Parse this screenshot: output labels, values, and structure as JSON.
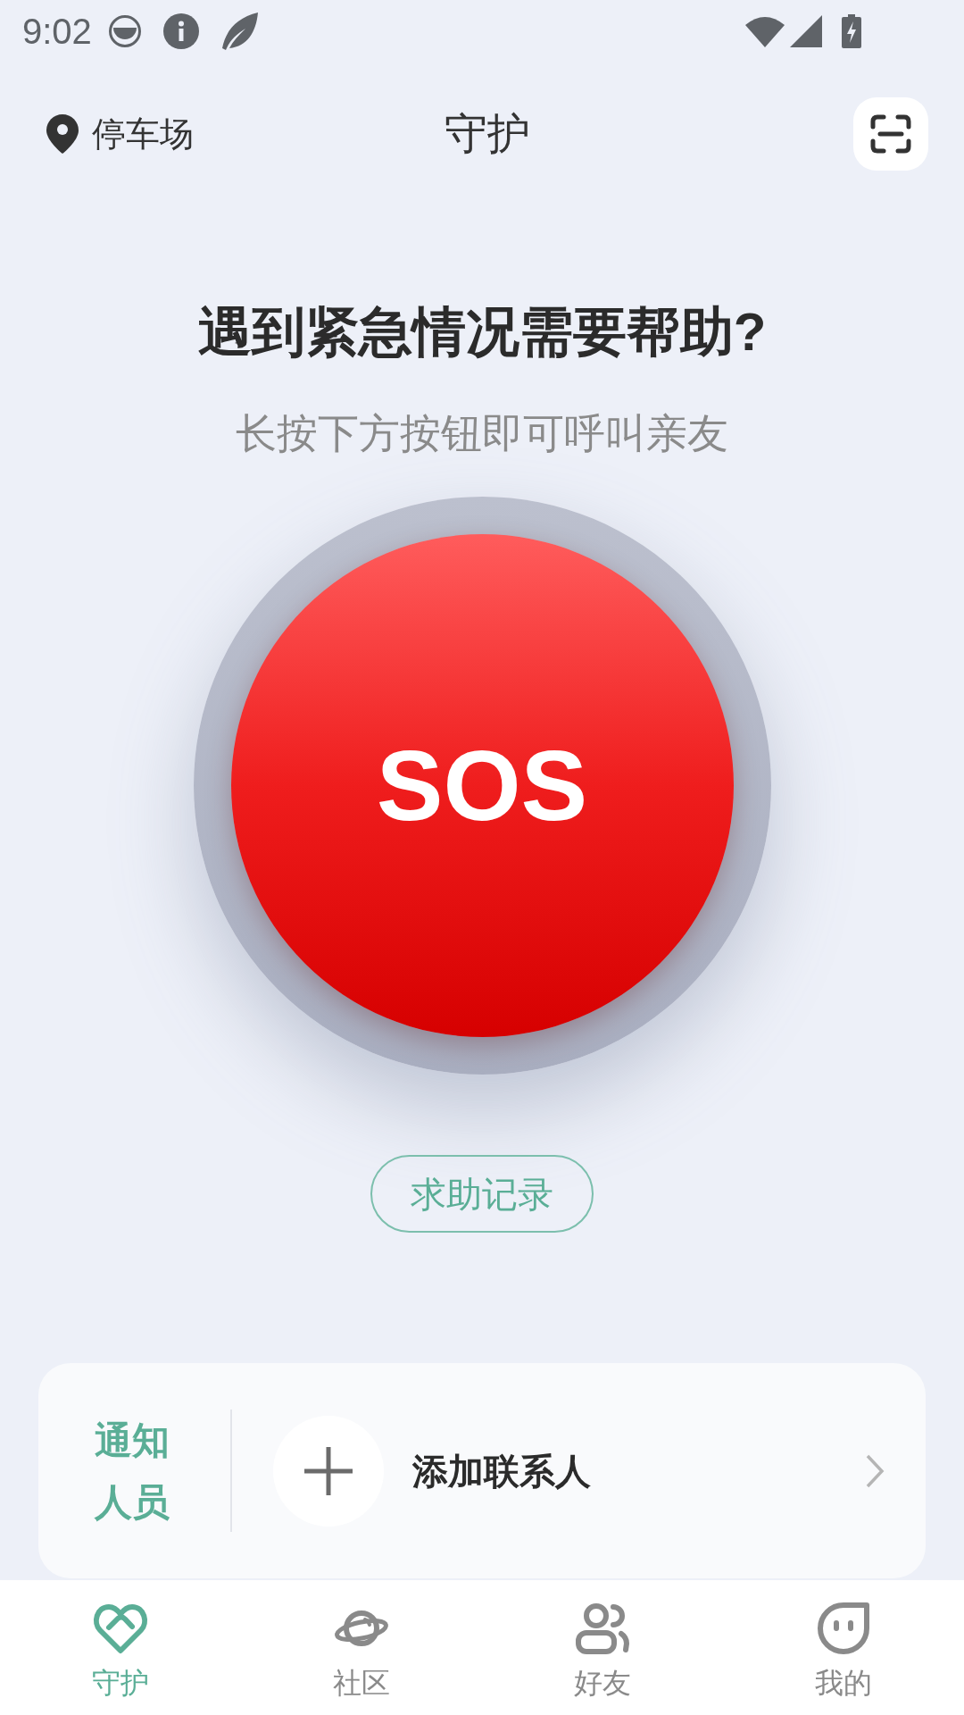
{
  "status_bar": {
    "time": "9:02"
  },
  "header": {
    "location": "停车场",
    "title": "守护"
  },
  "prompt": {
    "heading": "遇到紧急情况需要帮助?",
    "subtitle": "长按下方按钮即可呼叫亲友"
  },
  "sos_button": {
    "label": "SOS"
  },
  "history_button": {
    "label": "求助记录"
  },
  "contacts_card": {
    "label": "通知人员",
    "action": "添加联系人"
  },
  "bottom_nav": [
    {
      "label": "守护",
      "selected": true
    },
    {
      "label": "社区",
      "selected": false
    },
    {
      "label": "好友",
      "selected": false
    },
    {
      "label": "我的",
      "selected": false
    }
  ]
}
